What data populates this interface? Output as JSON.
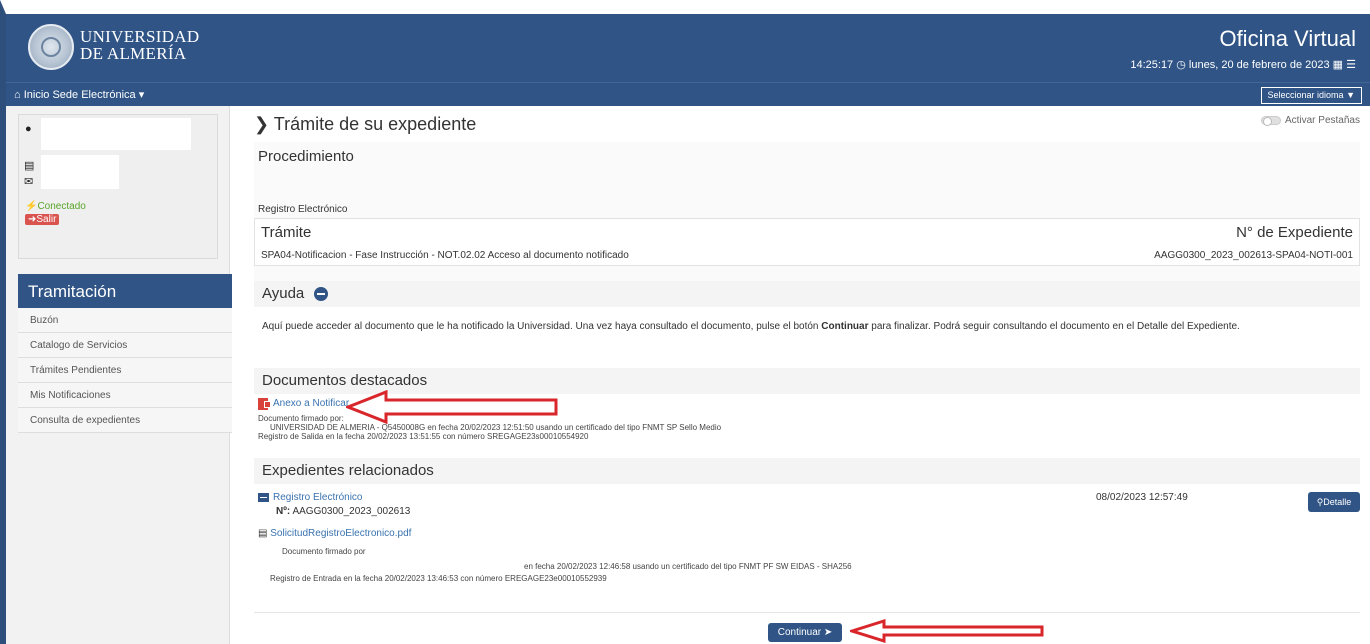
{
  "header": {
    "university_name_line1": "UNIVERSIDAD",
    "university_name_line2": "DE ALMERÍA",
    "brand_title": "Oficina Virtual",
    "time": "14:25:17",
    "date": "lunes, 20 de febrero de 2023"
  },
  "nav": {
    "home_label": "Inicio",
    "sede_label": "Sede Electrónica",
    "language_label": "Seleccionar idioma"
  },
  "user": {
    "status": "Conectado",
    "logout_label": "Salir"
  },
  "sidebar": {
    "title": "Tramitación",
    "items": [
      {
        "label": "Buzón"
      },
      {
        "label": "Catalogo de Servicios"
      },
      {
        "label": "Trámites Pendientes"
      },
      {
        "label": "Mis Notificaciones"
      },
      {
        "label": "Consulta de expedientes"
      }
    ]
  },
  "main": {
    "title": "Trámite de su expediente",
    "toggle_label": "Activar Pestañas",
    "procedimiento_label": "Procedimiento",
    "procedimiento_value": "Registro Electrónico",
    "tramite_label": "Trámite",
    "tramite_value": "SPA04-Notificacion - Fase Instrucción - NOT.02.02 Acceso al documento notificado",
    "expediente_label": "N° de Expediente",
    "expediente_value": "AAGG0300_2023_002613-SPA04-NOTI-001",
    "ayuda_title": "Ayuda",
    "help_text_part1": "Aquí puede acceder al documento que le ha notificado la Universidad. Una vez haya consultado el documento, pulse el botón ",
    "help_text_bold": "Continuar",
    "help_text_part2": " para finalizar. Podrá seguir consultando el documento en el Detalle del Expediente.",
    "docs_title": "Documentos destacados",
    "doc": {
      "name": "Anexo a Notificar",
      "signed_by_label": "Documento firmado por:",
      "signed_by_line": "UNIVERSIDAD DE ALMERIA - Q5450008G en fecha 20/02/2023 12:51:50  usando un certificado del tipo  FNMT SP Sello Medio",
      "registry_line": "Registro de Salida en la fecha 20/02/2023 13:51:55 con número  SREGAGE23s00010554920"
    },
    "rel_title": "Expedientes relacionados",
    "rel": {
      "name": "Registro Electrónico",
      "number_label": "Nº:",
      "number_value": "AAGG0300_2023_002613",
      "date": "08/02/2023 12:57:49",
      "detail_label": "Detalle",
      "file_name": "SolicitudRegistroElectronico.pdf",
      "signed_by_label": "Documento firmado por",
      "signed_line": "en fecha 20/02/2023 12:46:58  usando un certificado del tipo  FNMT PF SW EIDAS - SHA256",
      "registry_line": "Registro de Entrada en la fecha 20/02/2023 13:46:53 con número  EREGAGE23e00010552939"
    },
    "continue_label": "Continuar"
  },
  "colors": {
    "primary": "#2f5485",
    "link": "#3a73b0",
    "danger": "#d9534f",
    "success": "#5aa52a",
    "annotation_arrow": "#d8262b"
  }
}
